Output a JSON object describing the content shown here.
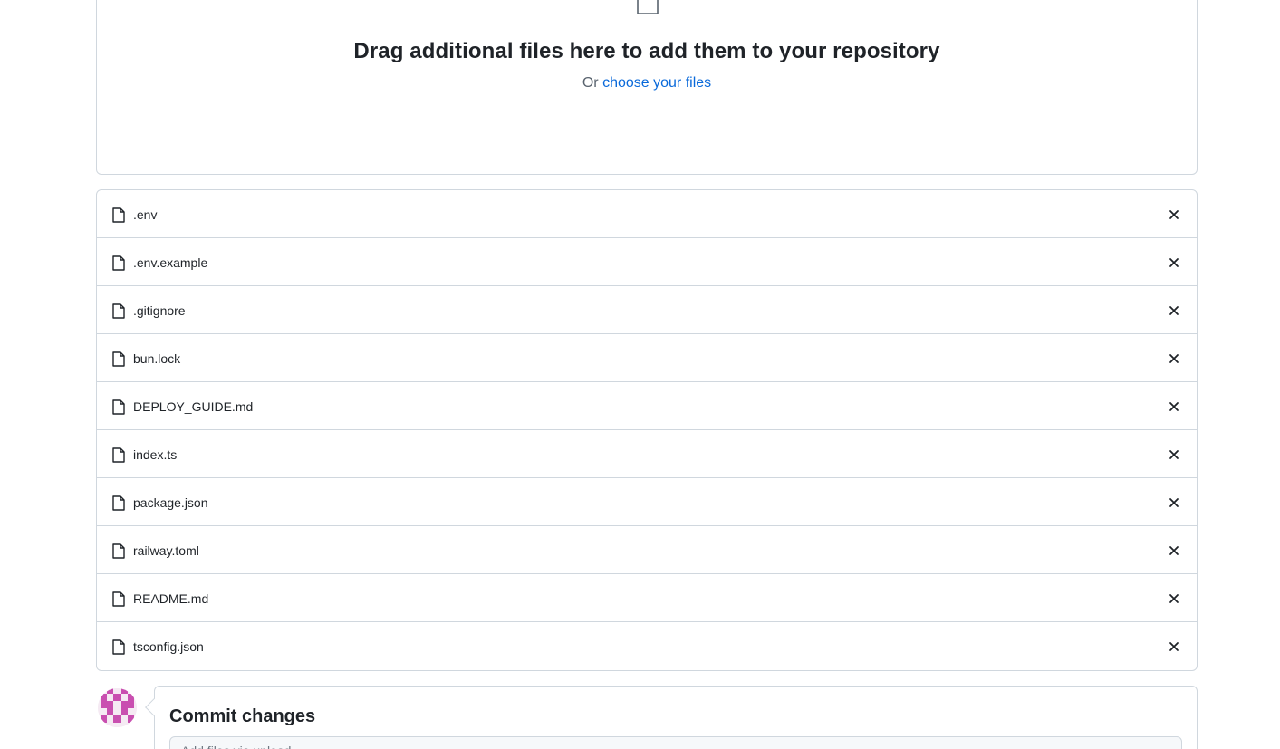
{
  "dropzone": {
    "title": "Drag additional files here to add them to your repository",
    "or_text": "Or",
    "choose_link": "choose your files",
    "icon": "file-icon"
  },
  "files": [
    {
      "name": ".env"
    },
    {
      "name": ".env.example"
    },
    {
      "name": ".gitignore"
    },
    {
      "name": "bun.lock"
    },
    {
      "name": "DEPLOY_GUIDE.md"
    },
    {
      "name": "index.ts"
    },
    {
      "name": "package.json"
    },
    {
      "name": "railway.toml"
    },
    {
      "name": "README.md"
    },
    {
      "name": "tsconfig.json"
    }
  ],
  "commit": {
    "title": "Commit changes",
    "message_placeholder": "Add files via upload",
    "message_value": ""
  },
  "colors": {
    "link": "#0969da",
    "border": "#d0d7de",
    "avatar": "#c94fb0"
  }
}
